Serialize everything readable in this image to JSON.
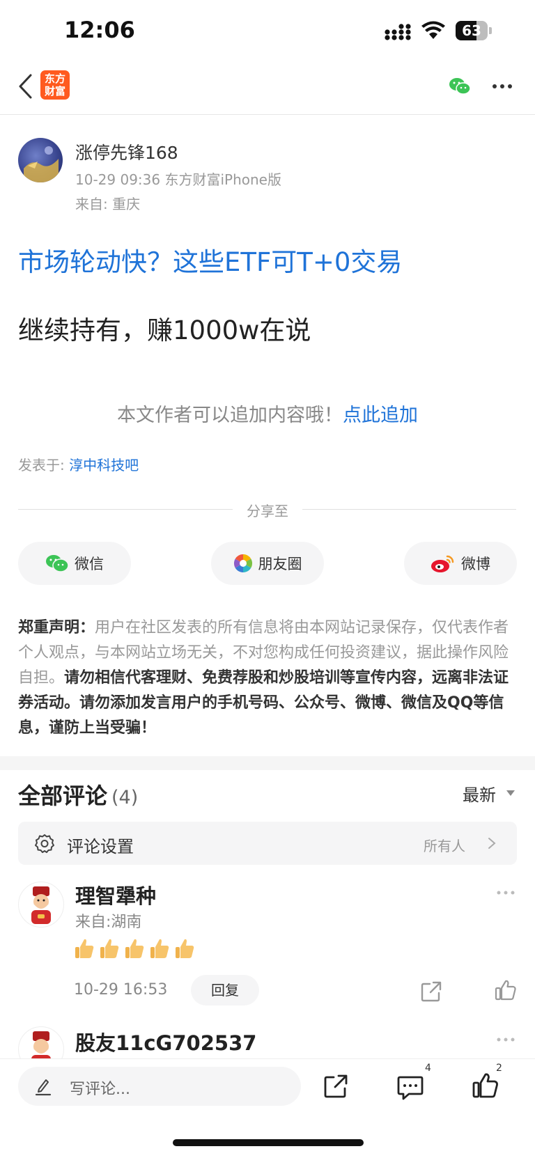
{
  "status_bar": {
    "time": "12:06",
    "battery": "63"
  },
  "nav": {
    "logo_line1": "东方",
    "logo_line2": "财富"
  },
  "post": {
    "author": "涨停先锋168",
    "meta": "10-29 09:36 东方财富iPhone版",
    "from": "来自: 重庆",
    "link_title": "市场轮动快？这些ETF可T+0交易",
    "body": "继续持有，赚1000w在说",
    "append_prompt": "本文作者可以追加内容哦！",
    "append_link": "点此追加",
    "forum_prefix": "发表于: ",
    "forum_name": "淳中科技吧"
  },
  "share": {
    "label": "分享至",
    "wechat": "微信",
    "moments": "朋友圈",
    "weibo": "微博"
  },
  "disclaimer": {
    "head": "郑重声明：",
    "normal": "用户在社区发表的所有信息将由本网站记录保存，仅代表作者个人观点，与本网站立场无关，不对您构成任何投资建议，据此操作风险自担。",
    "bold": "请勿相信代客理财、免费荐股和炒股培训等宣传内容，远离非法证券活动。请勿添加发言用户的手机号码、公众号、微博、微信及QQ等信息，谨防上当受骗！"
  },
  "comments": {
    "title": "全部评论",
    "count": "(4)",
    "sort": "最新",
    "settings_label": "评论设置",
    "settings_value": "所有人",
    "items": [
      {
        "name": "理智犟种",
        "from": "来自:湖南",
        "time": "10-29 16:53",
        "reply": "回复"
      },
      {
        "name": "股友11cG702537"
      }
    ]
  },
  "bottom_bar": {
    "placeholder": "写评论...",
    "comment_count": "4",
    "like_count": "2"
  },
  "colors": {
    "accent": "#1f73d8",
    "brand": "#ff5a1f"
  }
}
